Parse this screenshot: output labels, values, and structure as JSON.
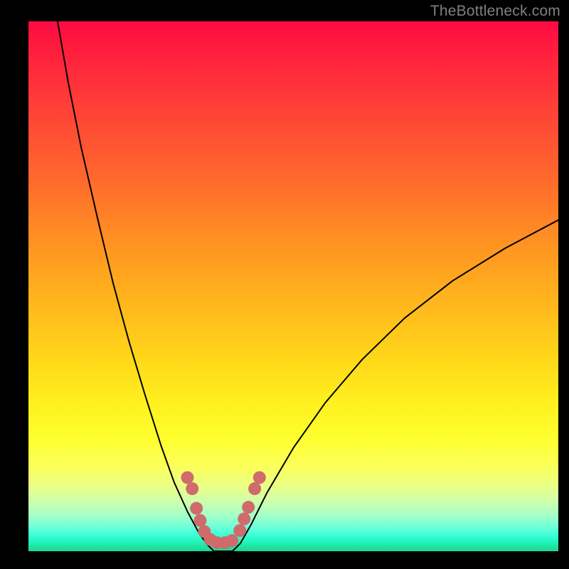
{
  "watermark": "TheBottleneck.com",
  "chart_data": {
    "type": "line",
    "title": "",
    "xlabel": "",
    "ylabel": "",
    "xlim": [
      0,
      1
    ],
    "ylim": [
      0,
      1
    ],
    "series": [
      {
        "name": "curve-left",
        "x": [
          0.055,
          0.075,
          0.1,
          0.13,
          0.16,
          0.19,
          0.22,
          0.25,
          0.275,
          0.3,
          0.323,
          0.338,
          0.35
        ],
        "y": [
          1.0,
          0.885,
          0.76,
          0.63,
          0.505,
          0.395,
          0.295,
          0.2,
          0.13,
          0.075,
          0.032,
          0.012,
          0.0
        ]
      },
      {
        "name": "curve-right",
        "x": [
          0.385,
          0.4,
          0.42,
          0.45,
          0.5,
          0.56,
          0.63,
          0.71,
          0.8,
          0.9,
          1.0
        ],
        "y": [
          0.0,
          0.015,
          0.05,
          0.11,
          0.195,
          0.28,
          0.362,
          0.44,
          0.51,
          0.572,
          0.625
        ]
      },
      {
        "name": "curve-floor",
        "x": [
          0.35,
          0.36,
          0.37,
          0.38,
          0.385
        ],
        "y": [
          0.0,
          0.0,
          0.0,
          0.0,
          0.0
        ]
      }
    ],
    "markers": {
      "name": "bead-cluster",
      "color": "#cf6b6b",
      "radius_px": 9,
      "points": [
        {
          "x": 0.3,
          "y": 0.139
        },
        {
          "x": 0.309,
          "y": 0.118
        },
        {
          "x": 0.317,
          "y": 0.081
        },
        {
          "x": 0.324,
          "y": 0.058
        },
        {
          "x": 0.332,
          "y": 0.037
        },
        {
          "x": 0.343,
          "y": 0.022
        },
        {
          "x": 0.356,
          "y": 0.016
        },
        {
          "x": 0.371,
          "y": 0.016
        },
        {
          "x": 0.384,
          "y": 0.02
        },
        {
          "x": 0.399,
          "y": 0.039
        },
        {
          "x": 0.407,
          "y": 0.061
        },
        {
          "x": 0.415,
          "y": 0.083
        },
        {
          "x": 0.427,
          "y": 0.118
        },
        {
          "x": 0.436,
          "y": 0.139
        }
      ]
    }
  }
}
